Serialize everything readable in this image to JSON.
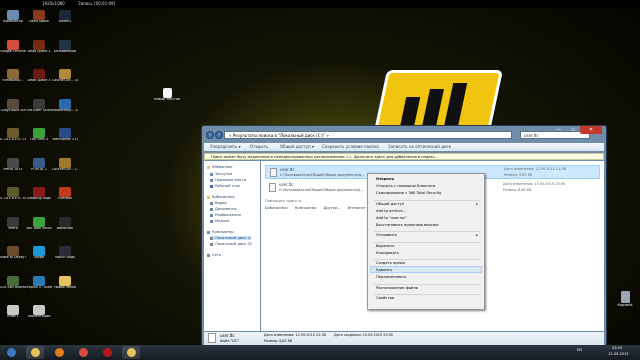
{
  "topbar": {
    "resolution": "1920x1080",
    "recording": "Запись [00:01:09]"
  },
  "desktop_icons": [
    {
      "label": "Компьютер",
      "color": "#6a89b3"
    },
    {
      "label": "Dead Space",
      "color": "#8a3a1a"
    },
    {
      "label": "steam2",
      "color": "#1b2838"
    },
    {
      "label": "Google Chrome",
      "color": "#d94c3d"
    },
    {
      "label": "Dead Space 2",
      "color": "#7a2a12"
    },
    {
      "label": "Безымянный",
      "color": "#223344"
    },
    {
      "label": "RimWorld0...",
      "color": "#8a6a3a"
    },
    {
      "label": "Dead Space 3",
      "color": "#6a1a10"
    },
    {
      "label": "Counter-Str... Global Offe...",
      "color": "#b08a3a"
    },
    {
      "label": "7DaysToDie Survive",
      "color": "#5a4a3a"
    },
    {
      "label": "The Elder Scrolls 5 Sk...",
      "color": "#3a3a3a"
    },
    {
      "label": "MalwareByt... Anti-Malware",
      "color": "#2a6ab3"
    },
    {
      "label": "S.T.A.L.K.E.R. Call of Pri...",
      "color": "#6a5a2a"
    },
    {
      "label": "The Sims 3",
      "color": "#3aa33a"
    },
    {
      "label": "TeamSpeak 3 Client",
      "color": "#2a4a8a"
    },
    {
      "label": "Metro 2033",
      "color": "#4a4a4a"
    },
    {
      "label": "PORTAL 2",
      "color": "#3a5a8a"
    },
    {
      "label": "Counter-Str... 1.6",
      "color": "#a07a2a"
    },
    {
      "label": "S.T.A.L.K.E.R. Shadow...",
      "color": "#5a5a2a"
    },
    {
      "label": "Sleeping Dogs",
      "color": "#8a1a1a"
    },
    {
      "label": "Overwolf",
      "color": "#c33a1a"
    },
    {
      "label": "Metro",
      "color": "#3a3a3a"
    },
    {
      "label": "360 Total Security",
      "color": "#3aa33a"
    },
    {
      "label": "Bandicam",
      "color": "#2a2a2a"
    },
    {
      "label": "State of Decay Ob...",
      "color": "#6a4a2a"
    },
    {
      "label": "Skype",
      "color": "#1a9ad6"
    },
    {
      "label": "Watch Dogs",
      "color": "#2a2a3a"
    },
    {
      "label": "GTA San Andreas",
      "color": "#4a6a3a"
    },
    {
      "label": "Tropico 5 - Steam Sp...",
      "color": "#2a7ab3"
    },
    {
      "label": "Новая папка",
      "color": "#e6c35c"
    },
    {
      "label": "стим 1",
      "color": "#c8c8c8"
    },
    {
      "label": "презентации",
      "color": "#c8c8c8"
    }
  ],
  "desktop_file": {
    "label": "Новый текстов..."
  },
  "recycle_bin": {
    "label": "Корзина"
  },
  "explorer": {
    "address": "« Результаты поиска в \"Локальный диск (C:)\" »",
    "search_value": "user.Itc",
    "back_icon": "back-arrow-icon",
    "forward_icon": "forward-arrow-icon",
    "controls": [
      "—",
      "▫",
      "✕"
    ],
    "toolbar": {
      "organize": "Упорядочить ▾",
      "open": "Открыть",
      "share": "Общий доступ ▾",
      "save_search": "Сохранить условия поиска",
      "burn": "Записать на оптический диск"
    },
    "infobar": "Поиск может быть медленным в неиндексированных расположениях: C:\\. Щелкните здесь для добавления в индекс...",
    "nav": [
      {
        "label": "Избранное",
        "color": "#e6c35c"
      },
      {
        "label": "Загрузки",
        "color": "#6a89b3"
      },
      {
        "label": "Недавние места",
        "color": "#6a89b3"
      },
      {
        "label": "Рабочий стол",
        "color": "#3a6ab3"
      },
      {
        "label": "Библиотеки",
        "color": "#e6c35c"
      },
      {
        "label": "Видео",
        "color": "#6a89b3"
      },
      {
        "label": "Документы",
        "color": "#6a89b3"
      },
      {
        "label": "Изображения",
        "color": "#6a89b3"
      },
      {
        "label": "Музыка",
        "color": "#6a89b3"
      },
      {
        "label": "Компьютер",
        "color": "#6a89b3"
      },
      {
        "label": "Локальный диск (C",
        "color": "#888888"
      },
      {
        "label": "Локальный диск (D",
        "color": "#888888"
      },
      {
        "label": "Сеть",
        "color": "#6a89b3"
      }
    ],
    "results": [
      {
        "name": "user.Itc",
        "path": "C:\\Пользователи\\Общие\\Общие документы\\Ц...",
        "date": "Дата изменения: 12.09.2015 21:38",
        "size": "Размер: 4,83 КБ"
      },
      {
        "name": "user.Itc",
        "path": "C:\\Пользователи\\Общие\\Общие документы\\Ц...",
        "date": "Дата изменения: 15.05.2015 23:46",
        "size": "Размер: 8,46 КБ"
      }
    ],
    "search_again": "Повторить поиск в:",
    "search_again_items": [
      "Библиотеки",
      "Компьютер",
      "Другое...",
      "Интернет"
    ],
    "details": {
      "name": "user.Itc",
      "type": "Файл \"LTC\"",
      "modified": "Дата изменения: 12.09.2015 21:38",
      "size": "Размер: 4,83 КБ",
      "created": "Дата создания: 15.05.2015 23:35"
    }
  },
  "context_menu": [
    {
      "label": "Открыть",
      "bold": true
    },
    {
      "label": "Открыть с помощью Блокнота"
    },
    {
      "label": "Сканирование с 360 Total Security"
    },
    {
      "sep": true
    },
    {
      "label": "Общий доступ",
      "arrow": true
    },
    {
      "label": "Add to archive..."
    },
    {
      "label": "Add to \"user.rar\""
    },
    {
      "label": "Восстановить прежнюю версию"
    },
    {
      "sep": true
    },
    {
      "label": "Отправить",
      "arrow": true
    },
    {
      "sep": true
    },
    {
      "label": "Вырезать"
    },
    {
      "label": "Копировать"
    },
    {
      "sep": true
    },
    {
      "label": "Создать ярлык"
    },
    {
      "label": "Удалить"
    },
    {
      "label": "Переименовать"
    },
    {
      "sep": true
    },
    {
      "label": "Расположение файла"
    },
    {
      "sep": true
    },
    {
      "label": "Свойства"
    }
  ],
  "taskbar": {
    "apps": [
      {
        "name": "start-button",
        "color": "#3a7ac3"
      },
      {
        "name": "explorer-taskbar",
        "color": "#e6c35c"
      },
      {
        "name": "media-player-taskbar",
        "color": "#e07a1a"
      },
      {
        "name": "chrome-taskbar",
        "color": "#d94c3d"
      },
      {
        "name": "bandicam-taskbar",
        "color": "#b31a1a"
      },
      {
        "name": "folder-taskbar",
        "color": "#e6c35c"
      }
    ],
    "lang": "EN",
    "time": "23:25",
    "date": "12.09.2015"
  }
}
